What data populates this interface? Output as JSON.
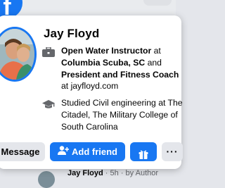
{
  "profile": {
    "name": "Jay Floyd"
  },
  "work": {
    "part1": "Open Water Instructor",
    "at1": " at ",
    "org1": "Columbia Scuba, SC",
    "and": " and ",
    "part2": "President and Fitness Coach",
    "at2": " at ",
    "site": "jayfloyd.com"
  },
  "education": {
    "text": "Studied Civil engineering at The Citadel, The Military College of South Carolina"
  },
  "buttons": {
    "message": "Message",
    "add_friend": "Add friend",
    "more": "···"
  },
  "feed": {
    "author": "Jay Floyd",
    "meta": " · 5h · ",
    "by_author": "by Author"
  },
  "icons": {
    "logo": "facebook-logo",
    "work": "briefcase-icon",
    "education": "graduation-cap-icon",
    "add_friend": "add-person-icon",
    "gift": "gift-icon",
    "more": "more-dots-icon"
  },
  "colors": {
    "accent": "#1877f2",
    "text": "#050505",
    "secondary_text": "#65676b",
    "button_gray": "#e4e6eb"
  }
}
